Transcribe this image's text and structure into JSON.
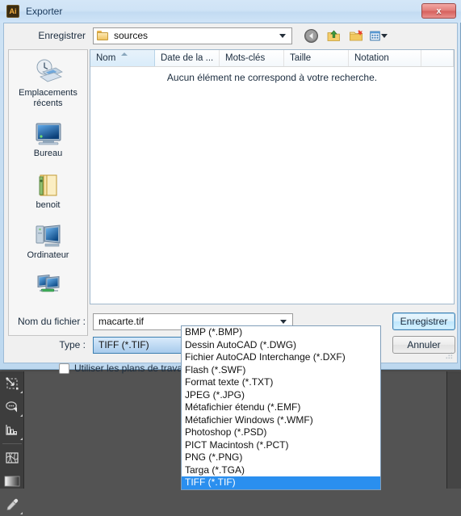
{
  "workspace": {
    "background_color": "#535353",
    "tool_panel_color": "#3d3d3d",
    "tools": [
      {
        "name": "free-transform-tool",
        "icon": "free-transform-icon"
      },
      {
        "name": "symbol-sprayer-tool",
        "icon": "symbol-sprayer-icon"
      },
      {
        "name": "column-graph-tool",
        "icon": "column-graph-icon"
      },
      {
        "name": "mesh-tool",
        "icon": "mesh-icon"
      },
      {
        "name": "gradient-tool",
        "icon": "gradient-icon"
      },
      {
        "name": "eyedropper-tool",
        "icon": "eyedropper-icon"
      }
    ]
  },
  "dialog": {
    "app_icon_label": "Ai",
    "title": "Exporter",
    "close_label": "x",
    "accent_color": "#2a8fef",
    "save_in": {
      "label": "Enregistrer",
      "folder": "sources"
    },
    "nav": {
      "back_icon": "back-arrow-icon",
      "up_icon": "up-folder-icon",
      "new_folder_icon": "new-folder-icon",
      "views_icon": "views-icon"
    },
    "places": [
      {
        "label": "Emplacements récents",
        "icon": "recent-places-icon"
      },
      {
        "label": "Bureau",
        "icon": "desktop-icon"
      },
      {
        "label": "benoit",
        "icon": "user-folder-icon"
      },
      {
        "label": "Ordinateur",
        "icon": "computer-icon"
      },
      {
        "label": "",
        "icon": "network-icon"
      }
    ],
    "file_list": {
      "columns": [
        {
          "label": "Nom",
          "sorted": true,
          "sort_direction": "asc"
        },
        {
          "label": "Date de la ...",
          "sorted": false
        },
        {
          "label": "Mots-clés",
          "sorted": false
        },
        {
          "label": "Taille",
          "sorted": false
        },
        {
          "label": "Notation",
          "sorted": false
        },
        {
          "label": "",
          "sorted": false
        }
      ],
      "empty_message": "Aucun élément ne correspond à votre recherche.",
      "rows": []
    },
    "filename": {
      "label": "Nom du fichier :",
      "value": "macarte.tif"
    },
    "filetype": {
      "label": "Type :",
      "value": "TIFF (*.TIF)"
    },
    "buttons": {
      "save": "Enregistrer",
      "cancel": "Annuler"
    },
    "artboard_option": {
      "label": "Utiliser les plans de travail (",
      "checked": false
    },
    "type_options": [
      {
        "label": "BMP (*.BMP)",
        "selected": false
      },
      {
        "label": "Dessin AutoCAD (*.DWG)",
        "selected": false
      },
      {
        "label": "Fichier AutoCAD Interchange (*.DXF)",
        "selected": false
      },
      {
        "label": "Flash (*.SWF)",
        "selected": false
      },
      {
        "label": "Format texte (*.TXT)",
        "selected": false
      },
      {
        "label": "JPEG (*.JPG)",
        "selected": false
      },
      {
        "label": "Métafichier étendu (*.EMF)",
        "selected": false
      },
      {
        "label": "Métafichier Windows (*.WMF)",
        "selected": false
      },
      {
        "label": "Photoshop (*.PSD)",
        "selected": false
      },
      {
        "label": "PICT Macintosh (*.PCT)",
        "selected": false
      },
      {
        "label": "PNG (*.PNG)",
        "selected": false
      },
      {
        "label": "Targa (*.TGA)",
        "selected": false
      },
      {
        "label": "TIFF (*.TIF)",
        "selected": true
      }
    ]
  }
}
